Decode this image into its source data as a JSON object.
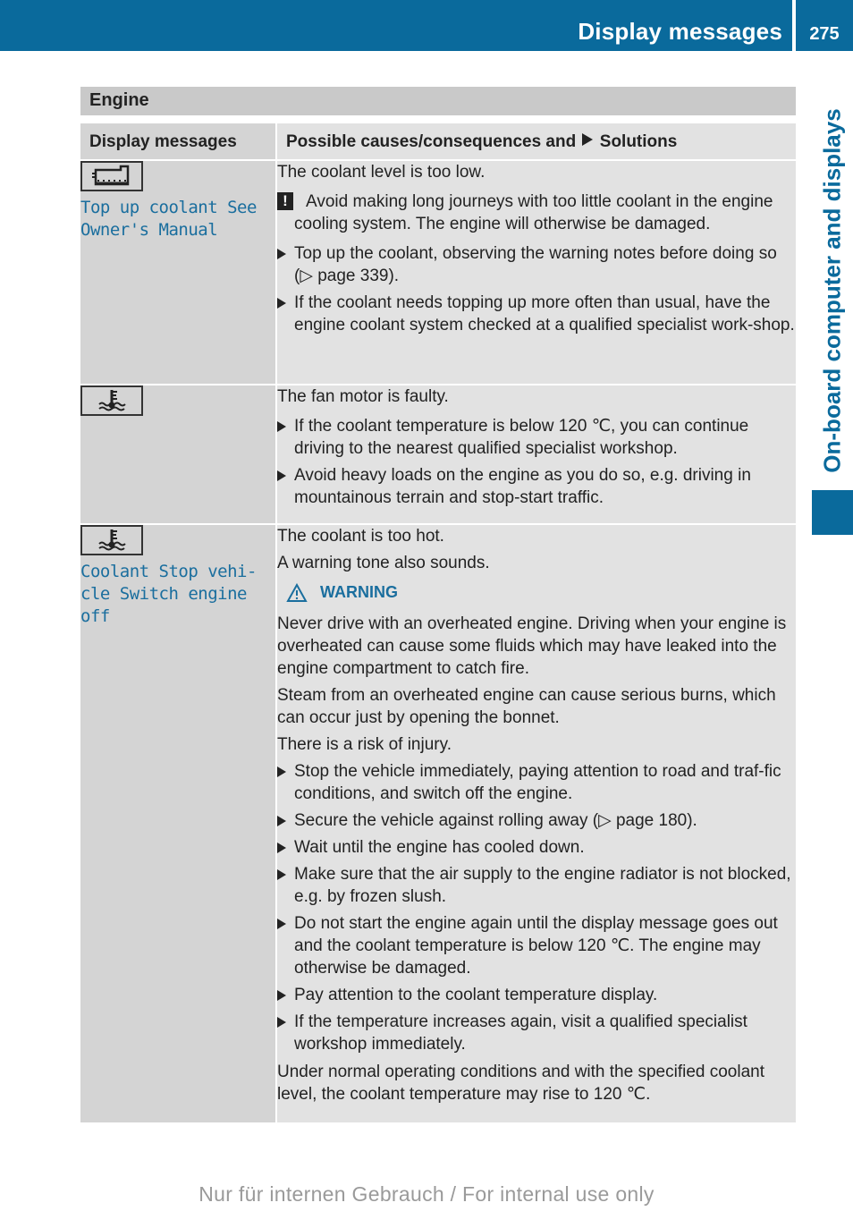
{
  "header": {
    "title": "Display messages",
    "page_number": "275",
    "side_tab": "On-board computer and displays"
  },
  "section": {
    "title": "Engine"
  },
  "table": {
    "col1_header": "Display messages",
    "col2_header_pre": "Possible causes/consequences and",
    "col2_header_post": "Solutions",
    "rows": [
      {
        "icon": "coolant-reservoir-icon",
        "message": "Top up coolant See Owner's Manual",
        "intro": "The coolant level is too low.",
        "notice": "Avoid making long journeys with too little coolant in the engine cooling system. The engine will otherwise be damaged.",
        "steps": [
          "Top up the coolant, observing the warning notes before doing so (▷ page 339).",
          "If the coolant needs topping up more often than usual, have the engine coolant system checked at a qualified specialist work-shop."
        ]
      },
      {
        "icon": "coolant-temperature-icon",
        "message": "",
        "intro": "The fan motor is faulty.",
        "steps": [
          "If the coolant temperature is below 120 ℃, you can continue driving to the nearest qualified specialist workshop.",
          "Avoid heavy loads on the engine as you do so, e.g. driving in mountainous terrain and stop-start traffic."
        ]
      },
      {
        "icon": "coolant-temperature-icon",
        "message": "Coolant Stop vehi-cle Switch engine off",
        "intro_lines": [
          "The coolant is too hot.",
          "A warning tone also sounds."
        ],
        "warning_label": "WARNING",
        "warning_paragraphs": [
          "Never drive with an overheated engine. Driving when your engine is overheated can cause some fluids which may have leaked into the engine compartment to catch fire.",
          "Steam from an overheated engine can cause serious burns, which can occur just by opening the bonnet.",
          "There is a risk of injury."
        ],
        "steps": [
          "Stop the vehicle immediately, paying attention to road and traf-fic conditions, and switch off the engine.",
          "Secure the vehicle against rolling away (▷ page 180).",
          "Wait until the engine has cooled down.",
          "Make sure that the air supply to the engine radiator is not blocked, e.g. by frozen slush.",
          "Do not start the engine again until the display message goes out and the coolant temperature is below 120 ℃. The engine may otherwise be damaged.",
          "Pay attention to the coolant temperature display.",
          "If the temperature increases again, visit a qualified specialist workshop immediately."
        ],
        "closing": "Under normal operating conditions and with the specified coolant level, the coolant temperature may rise to 120 ℃."
      }
    ]
  },
  "footer": {
    "text": "Nur für internen Gebrauch / For internal use only"
  },
  "colors": {
    "brand_blue": "#0a6a9c",
    "message_blue": "#1a6e9e",
    "header_gray": "#c9c9c9",
    "col1_gray": "#d4d4d4",
    "col2_gray": "#e2e2e2"
  }
}
